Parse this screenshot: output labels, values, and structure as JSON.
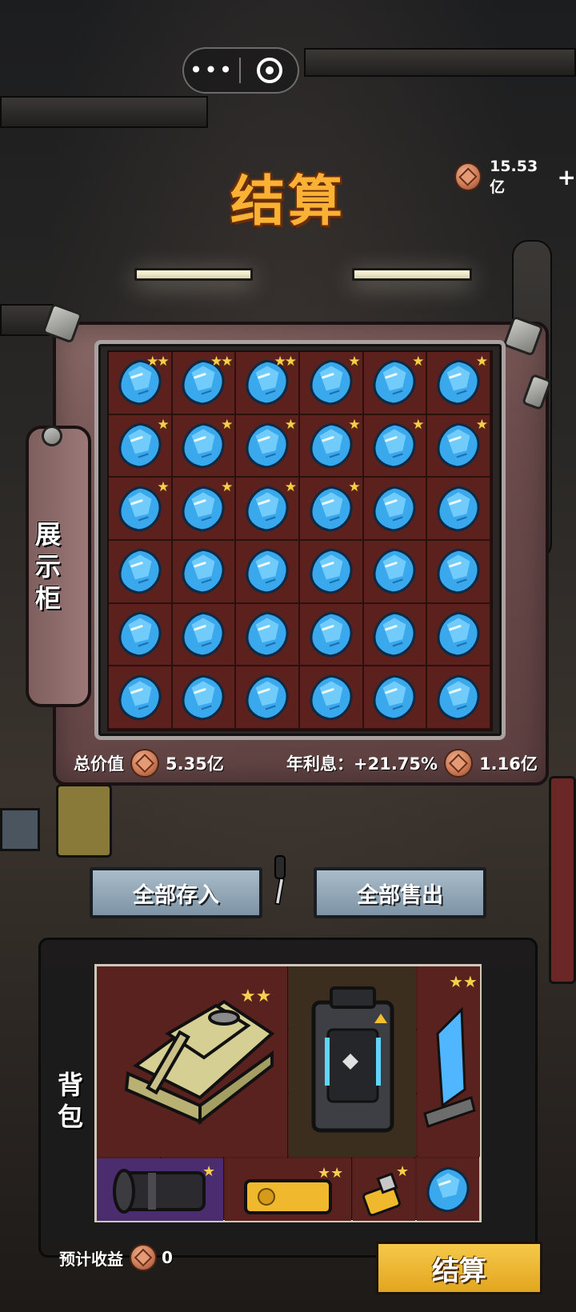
{
  "capsule": {
    "more_label": "•••",
    "target_icon": "target-icon"
  },
  "title": "结算",
  "balance": {
    "amount": "15.53亿",
    "plus": "+"
  },
  "cabinet": {
    "label": "展示柜",
    "label_chars": [
      "展",
      "示",
      "柜"
    ],
    "grid": [
      [
        2,
        2,
        2,
        1,
        1,
        1
      ],
      [
        1,
        1,
        1,
        1,
        1,
        1
      ],
      [
        1,
        1,
        1,
        1,
        0,
        0
      ],
      [
        0,
        0,
        0,
        0,
        0,
        0
      ],
      [
        0,
        0,
        0,
        0,
        0,
        0
      ],
      [
        0,
        0,
        0,
        0,
        0,
        0
      ]
    ],
    "total_label": "总价值",
    "total_value": "5.35亿",
    "interest_label": "年利息：+21.75%",
    "interest_value": "1.16亿"
  },
  "buttons": {
    "deposit_all": "全部存入",
    "sell_all": "全部售出"
  },
  "backpack": {
    "label": "背包",
    "label_chars": [
      "背",
      "包"
    ],
    "items": [
      {
        "name": "tank",
        "stars": 2
      },
      {
        "name": "power-case",
        "stars": 0
      },
      {
        "name": "crystal-trophy",
        "stars": 2
      },
      {
        "name": "camera-lens",
        "stars": 1
      },
      {
        "name": "gold-bar",
        "stars": 2
      },
      {
        "name": "lighter",
        "stars": 1
      },
      {
        "name": "blue-gem",
        "stars": 0
      }
    ]
  },
  "estimate": {
    "label": "预计收益",
    "value": "0"
  },
  "settle_button": "结算",
  "colors": {
    "title": "#f9b233",
    "star": "#f6cf4e",
    "settle": "#f0b93a",
    "button": "#93a8b8",
    "cell": "#5c211d"
  }
}
